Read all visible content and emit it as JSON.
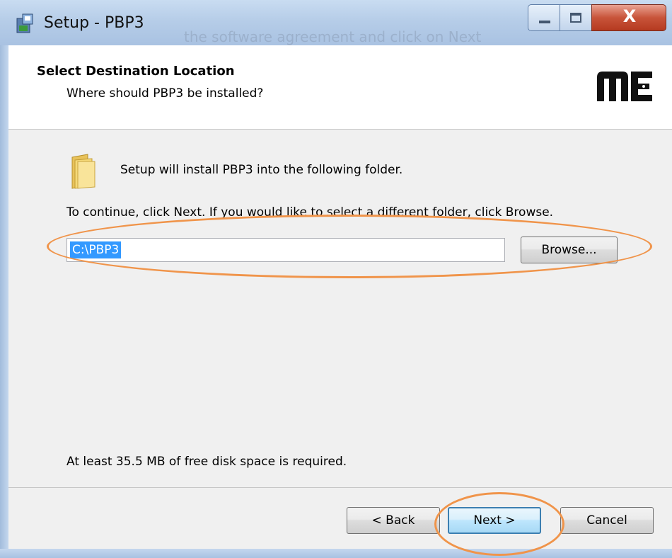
{
  "window": {
    "title": "Setup - PBP3",
    "background_text": "the software agreement and click on Next"
  },
  "titlebar_buttons": {
    "minimize_icon": "minimize-icon",
    "maximize_icon": "maximize-icon",
    "close_label": "X"
  },
  "header": {
    "title": "Select Destination Location",
    "subtitle": "Where should PBP3 be installed?",
    "logo_icon": "me-logo"
  },
  "body": {
    "folder_icon": "folder-icon",
    "install_text": "Setup will install PBP3 into the following folder.",
    "continue_text": "To continue, click Next. If you would like to select a different folder, click Browse.",
    "path_value": "C:\\PBP3",
    "browse_label": "Browse...",
    "disk_space_text": "At least 35.5 MB of free disk space is required."
  },
  "footer": {
    "back_label": "< Back",
    "next_label": "Next >",
    "cancel_label": "Cancel"
  },
  "colors": {
    "annotation": "#f0944a",
    "selection": "#3399ff",
    "close_button": "#c8543a"
  }
}
